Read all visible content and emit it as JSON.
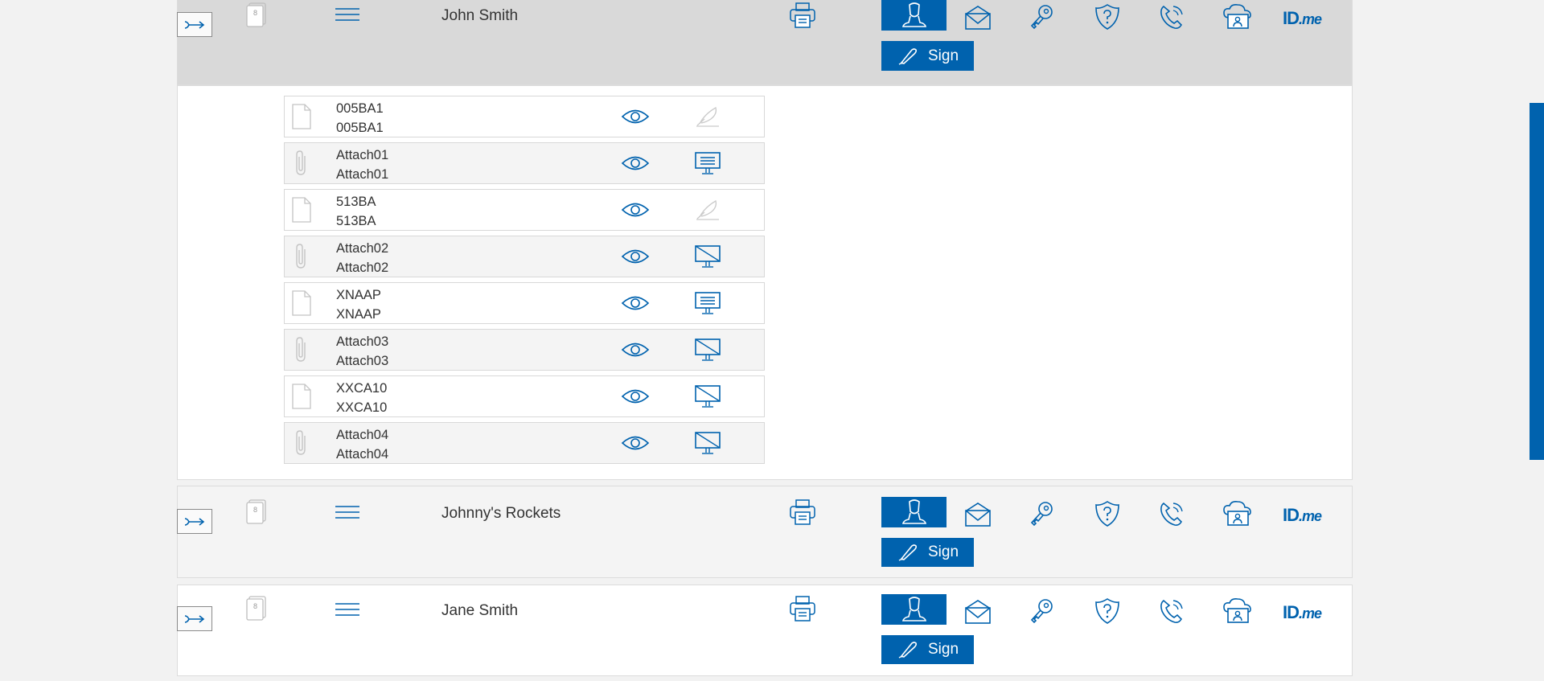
{
  "recipients": [
    {
      "name": "John Smith",
      "doc_count": "8",
      "sign_label": "Sign",
      "idme_id": "ID",
      "idme_me": ".me"
    },
    {
      "name": "Johnny's Rockets",
      "doc_count": "8",
      "sign_label": "Sign",
      "idme_id": "ID",
      "idme_me": ".me"
    },
    {
      "name": "Jane Smith",
      "doc_count": "8",
      "sign_label": "Sign",
      "idme_id": "ID",
      "idme_me": ".me"
    }
  ],
  "documents": [
    {
      "line1": "005BA1",
      "line2": "005BA1",
      "type": "file",
      "action": "sign-disabled"
    },
    {
      "line1": "Attach01",
      "line2": "Attach01",
      "type": "attachment",
      "action": "monitor"
    },
    {
      "line1": "513BA",
      "line2": "513BA",
      "type": "file",
      "action": "sign-disabled"
    },
    {
      "line1": "Attach02",
      "line2": "Attach02",
      "type": "attachment",
      "action": "monitor-off"
    },
    {
      "line1": "XNAAP",
      "line2": "XNAAP",
      "type": "file",
      "action": "monitor"
    },
    {
      "line1": "Attach03",
      "line2": "Attach03",
      "type": "attachment",
      "action": "monitor-off"
    },
    {
      "line1": "XXCA10",
      "line2": "XXCA10",
      "type": "file",
      "action": "monitor-off"
    },
    {
      "line1": "Attach04",
      "line2": "Attach04",
      "type": "attachment",
      "action": "monitor-off"
    }
  ],
  "icons": {
    "expander": "arrow-right-expand-icon",
    "doc_stack": "document-stack-icon",
    "menu": "hamburger-menu-icon",
    "print": "printer-icon",
    "auth": [
      "person-icon",
      "email-icon",
      "key-icon",
      "shield-question-icon",
      "phone-icon",
      "cloud-id-icon"
    ],
    "view": "eye-icon",
    "file": "file-icon",
    "attachment": "paperclip-icon"
  },
  "colors": {
    "accent": "#0062ae",
    "row_expanded": "#d9d9d9",
    "row_alt": "#f4f4f4"
  }
}
